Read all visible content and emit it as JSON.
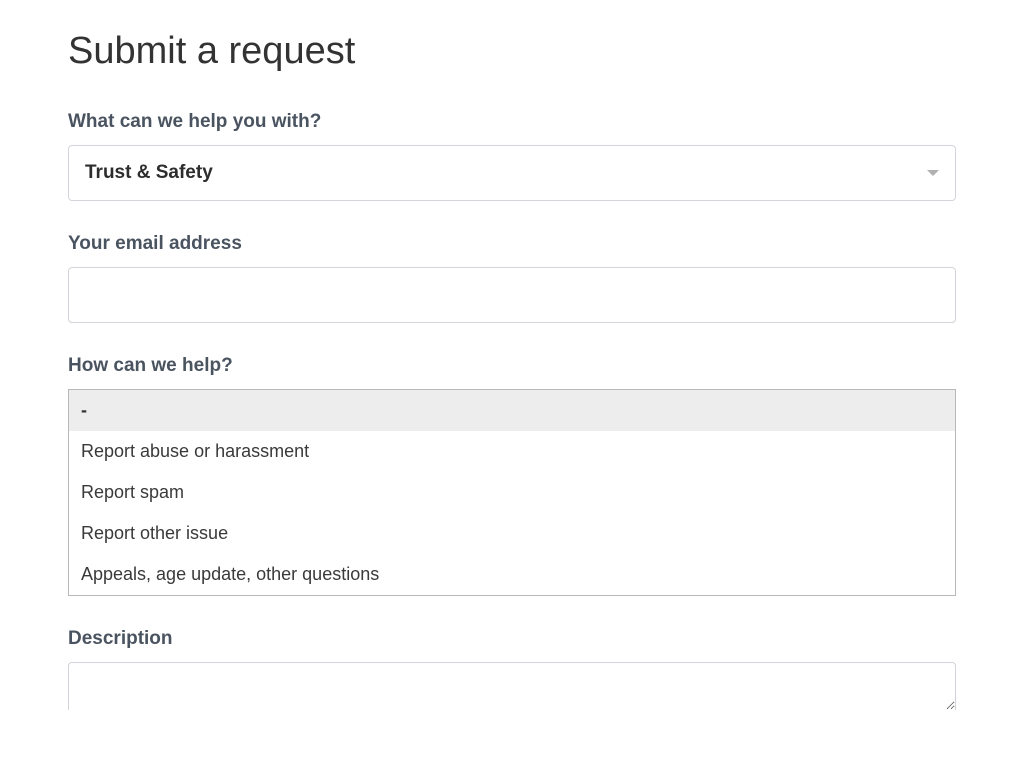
{
  "title": "Submit a request",
  "fields": {
    "help_with": {
      "label": "What can we help you with?",
      "value": "Trust & Safety"
    },
    "email": {
      "label": "Your email address",
      "value": ""
    },
    "how_help": {
      "label": "How can we help?",
      "selected": "-",
      "options": [
        "-",
        "Report abuse or harassment",
        "Report spam",
        "Report other issue",
        "Appeals, age update, other questions"
      ]
    },
    "description": {
      "label": "Description",
      "value": ""
    }
  }
}
